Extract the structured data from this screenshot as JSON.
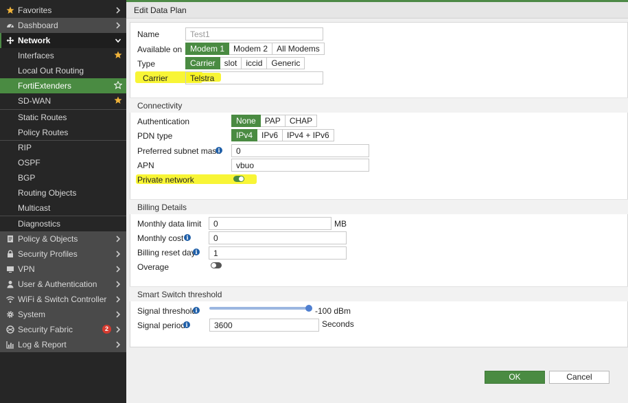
{
  "sidebar": {
    "items": [
      {
        "label": "Favorites"
      },
      {
        "label": "Dashboard"
      },
      {
        "label": "Network"
      },
      {
        "label": "Interfaces"
      },
      {
        "label": "Local Out Routing"
      },
      {
        "label": "FortiExtenders"
      },
      {
        "label": "SD-WAN"
      },
      {
        "label": "Static Routes"
      },
      {
        "label": "Policy Routes"
      },
      {
        "label": "RIP"
      },
      {
        "label": "OSPF"
      },
      {
        "label": "BGP"
      },
      {
        "label": "Routing Objects"
      },
      {
        "label": "Multicast"
      },
      {
        "label": "Diagnostics"
      },
      {
        "label": "Policy & Objects"
      },
      {
        "label": "Security Profiles"
      },
      {
        "label": "VPN"
      },
      {
        "label": "User & Authentication"
      },
      {
        "label": "WiFi & Switch Controller"
      },
      {
        "label": "System"
      },
      {
        "label": "Security Fabric",
        "badge": "2"
      },
      {
        "label": "Log & Report"
      }
    ]
  },
  "header": {
    "title": "Edit Data Plan"
  },
  "form": {
    "name_label": "Name",
    "name_placeholder": "Test1",
    "available_label": "Available on",
    "available_options": [
      "Modem 1",
      "Modem 2",
      "All Modems"
    ],
    "type_label": "Type",
    "type_options": [
      "Carrier",
      "slot",
      "iccid",
      "Generic"
    ],
    "carrier_label": "Carrier",
    "carrier_value": "Telstra"
  },
  "connectivity": {
    "title": "Connectivity",
    "auth_label": "Authentication",
    "auth_options": [
      "None",
      "PAP",
      "CHAP"
    ],
    "pdn_label": "PDN type",
    "pdn_options": [
      "IPv4",
      "IPv6",
      "IPv4 + IPv6"
    ],
    "subnet_label": "Preferred subnet mask",
    "subnet_value": "0",
    "apn_label": "APN",
    "apn_value": "vbuo",
    "private_label": "Private network",
    "private_enabled": true
  },
  "billing": {
    "title": "Billing Details",
    "limit_label": "Monthly data limit",
    "limit_value": "0",
    "limit_unit": "MB",
    "cost_label": "Monthly cost",
    "cost_value": "0",
    "reset_label": "Billing reset day",
    "reset_value": "1",
    "overage_label": "Overage",
    "overage_enabled": false
  },
  "smart": {
    "title": "Smart Switch threshold",
    "signal_label": "Signal threshold",
    "signal_value": "-100 dBm",
    "period_label": "Signal period",
    "period_value": "3600",
    "period_unit": "Seconds"
  },
  "actions": {
    "ok": "OK",
    "cancel": "Cancel"
  },
  "colors": {
    "accent": "#4a8b42",
    "highlight": "#f7f420",
    "sidebar_bg": "#262626"
  }
}
